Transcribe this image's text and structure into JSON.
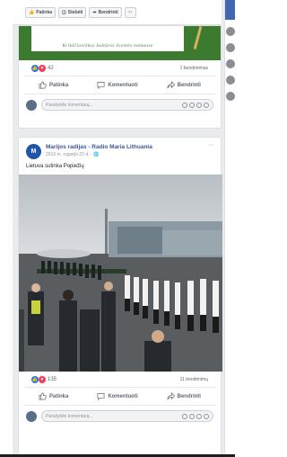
{
  "toolbar": {
    "buttons": [
      {
        "icon": "like-icon",
        "label": "Patinka"
      },
      {
        "icon": "comment-icon",
        "label": "Stebėti"
      },
      {
        "icon": "share-icon",
        "label": "Bendrinti"
      },
      {
        "icon": "more-icon",
        "label": "···"
      }
    ]
  },
  "post1": {
    "banner_text": "Krikščioniškos kultūros šventės namuose",
    "reaction_count": "42",
    "shares": "1 bendrinimas",
    "comment_placeholder": "Parašykite komentarą..."
  },
  "post2": {
    "author": "Marijos radijas - Radio Maria Lithuania",
    "meta": "2016 m. rugsėjo 22 d. ·",
    "text": "Lietuva sutinka Popiežių",
    "more": "···",
    "reaction_count": "135",
    "shares": "11 bendrinimų",
    "comment_placeholder": "Parašykite komentarą..."
  },
  "actions": {
    "like": "Patinka",
    "comment": "Komentuoti",
    "share": "Bendrinti"
  },
  "colors": {
    "facebook_blue": "#4267b2",
    "link_blue": "#385898",
    "banner_green": "#3c7a2f",
    "background": "#e9ebee"
  }
}
